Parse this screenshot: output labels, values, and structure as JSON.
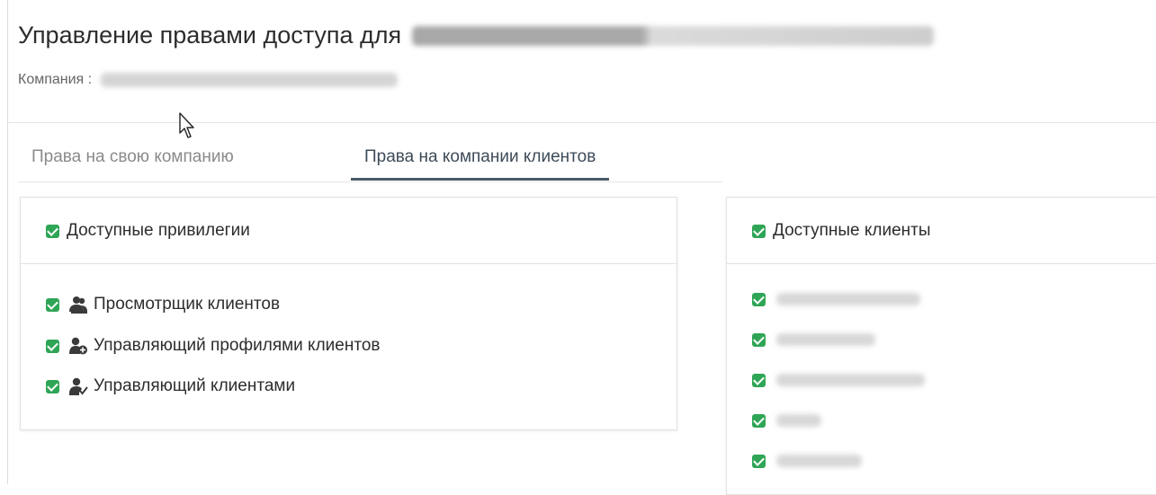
{
  "header": {
    "title": "Управление правами доступа для",
    "company_label": "Компания :"
  },
  "tabs": [
    {
      "label": "Права на свою компанию",
      "active": false
    },
    {
      "label": "Права на компании клиентов",
      "active": true
    }
  ],
  "privileges": {
    "header_label": "Доступные привилегии",
    "items": [
      {
        "label": "Просмотрщик клиентов",
        "icon": "users-view-icon"
      },
      {
        "label": "Управляющий профилями клиентов",
        "icon": "user-add-icon"
      },
      {
        "label": "Управляющий клиентами",
        "icon": "user-check-icon"
      }
    ]
  },
  "clients": {
    "header_label": "Доступные клиенты"
  },
  "colors": {
    "check": "#2fa556",
    "active_tab_underline": "#4a5a66"
  }
}
